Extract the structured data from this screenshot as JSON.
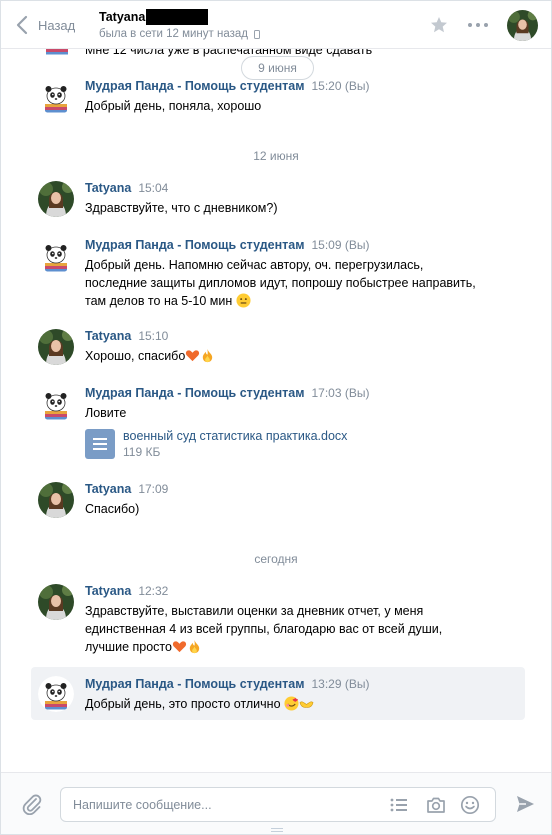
{
  "header": {
    "back_label": "Назад",
    "peer_name": "Tatyana",
    "peer_status": "была в сети 12 минут назад"
  },
  "history": {
    "cut_text": "Мне 12 числа уже в распечатанном виде сдавать",
    "floating_date": "9 июня",
    "dates": [
      "12 июня",
      "сегодня"
    ],
    "messages": [
      {
        "author": "Мудрая Панда - Помощь студентам",
        "time": "15:20",
        "suffix": "(Вы)",
        "text": "Добрый день, поняла, хорошо"
      },
      {
        "author": "Tatyana",
        "time": "15:04",
        "suffix": "",
        "text": "Здравствуйте, что с дневником?)"
      },
      {
        "author": "Мудрая Панда - Помощь студентам",
        "time": "15:09",
        "suffix": "(Вы)",
        "text": "Добрый день. Напомню сейчас автору, оч. перегрузилась, последние защиты дипломов идут, попрошу побыстрее направить, там делов то на 5-10 мин"
      },
      {
        "author": "Tatyana",
        "time": "15:10",
        "suffix": "",
        "text": "Хорошо, спасибо"
      },
      {
        "author": "Мудрая Панда - Помощь студентам",
        "time": "17:03",
        "suffix": "(Вы)",
        "text": "Ловите",
        "attachment": {
          "name": "военный суд статистика практика.docx",
          "size": "119 КБ"
        }
      },
      {
        "author": "Tatyana",
        "time": "17:09",
        "suffix": "",
        "text": "Спасибо)"
      },
      {
        "author": "Tatyana",
        "time": "12:32",
        "suffix": "",
        "text": "Здравствуйте, выставили оценки за дневник отчет, у меня единственная 4 из всей группы, благодарю вас от всей души, лучшие просто"
      },
      {
        "author": "Мудрая Панда - Помощь студентам",
        "time": "13:29",
        "suffix": "(Вы)",
        "text": "Добрый день, это просто отлично"
      }
    ]
  },
  "composer": {
    "placeholder": "Напишите сообщение...",
    "value": ""
  },
  "icons": {
    "back": "chevron-left-icon",
    "star": "star-icon",
    "more": "more-dots-icon",
    "phone": "mobile-phone-icon",
    "attach": "paperclip-icon",
    "template": "list-icon",
    "camera": "camera-icon",
    "emoji": "smile-icon",
    "send": "send-icon"
  },
  "colors": {
    "link": "#2a5885",
    "muted": "#818c99",
    "selected_bg": "#f0f2f5",
    "doc_icon": "#7a9cc6"
  }
}
